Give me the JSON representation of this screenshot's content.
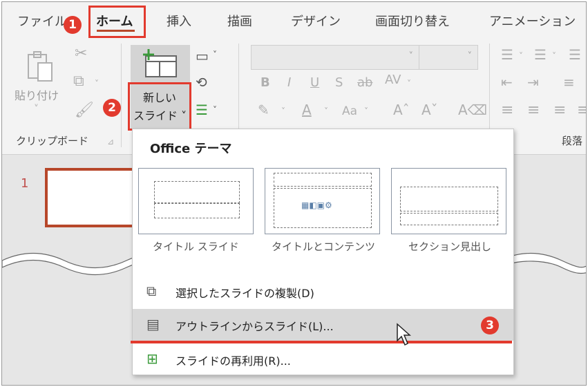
{
  "tabs": {
    "file": "ファイル",
    "home": "ホーム",
    "insert": "挿入",
    "draw": "描画",
    "design": "デザイン",
    "transitions": "画面切り替え",
    "animations": "アニメーション"
  },
  "ribbon": {
    "paste_label": "貼り付け",
    "clipboard_group": "クリップボード",
    "new_slide_line1": "新しい",
    "new_slide_line2": "スライド ˅",
    "paragraph_group": "段落"
  },
  "menu": {
    "section_header": "Office テーマ",
    "layouts": [
      {
        "name": "タイトル スライド"
      },
      {
        "name": "タイトルとコンテンツ"
      },
      {
        "name": "セクション見出し"
      }
    ],
    "items": [
      {
        "label": "選択したスライドの複製(D)",
        "icon": "duplicate-slide-icon"
      },
      {
        "label": "アウトラインからスライド(L)...",
        "icon": "outline-icon"
      },
      {
        "label": "スライドの再利用(R)...",
        "icon": "reuse-slide-icon"
      }
    ]
  },
  "thumbnails": {
    "slide_number": "1"
  },
  "badges": {
    "step1": "1",
    "step2": "2",
    "step3": "3"
  },
  "colors": {
    "accent_red": "#e23a2e",
    "ppt_orange": "#b7472a",
    "highlight": "#d9d9d9"
  }
}
